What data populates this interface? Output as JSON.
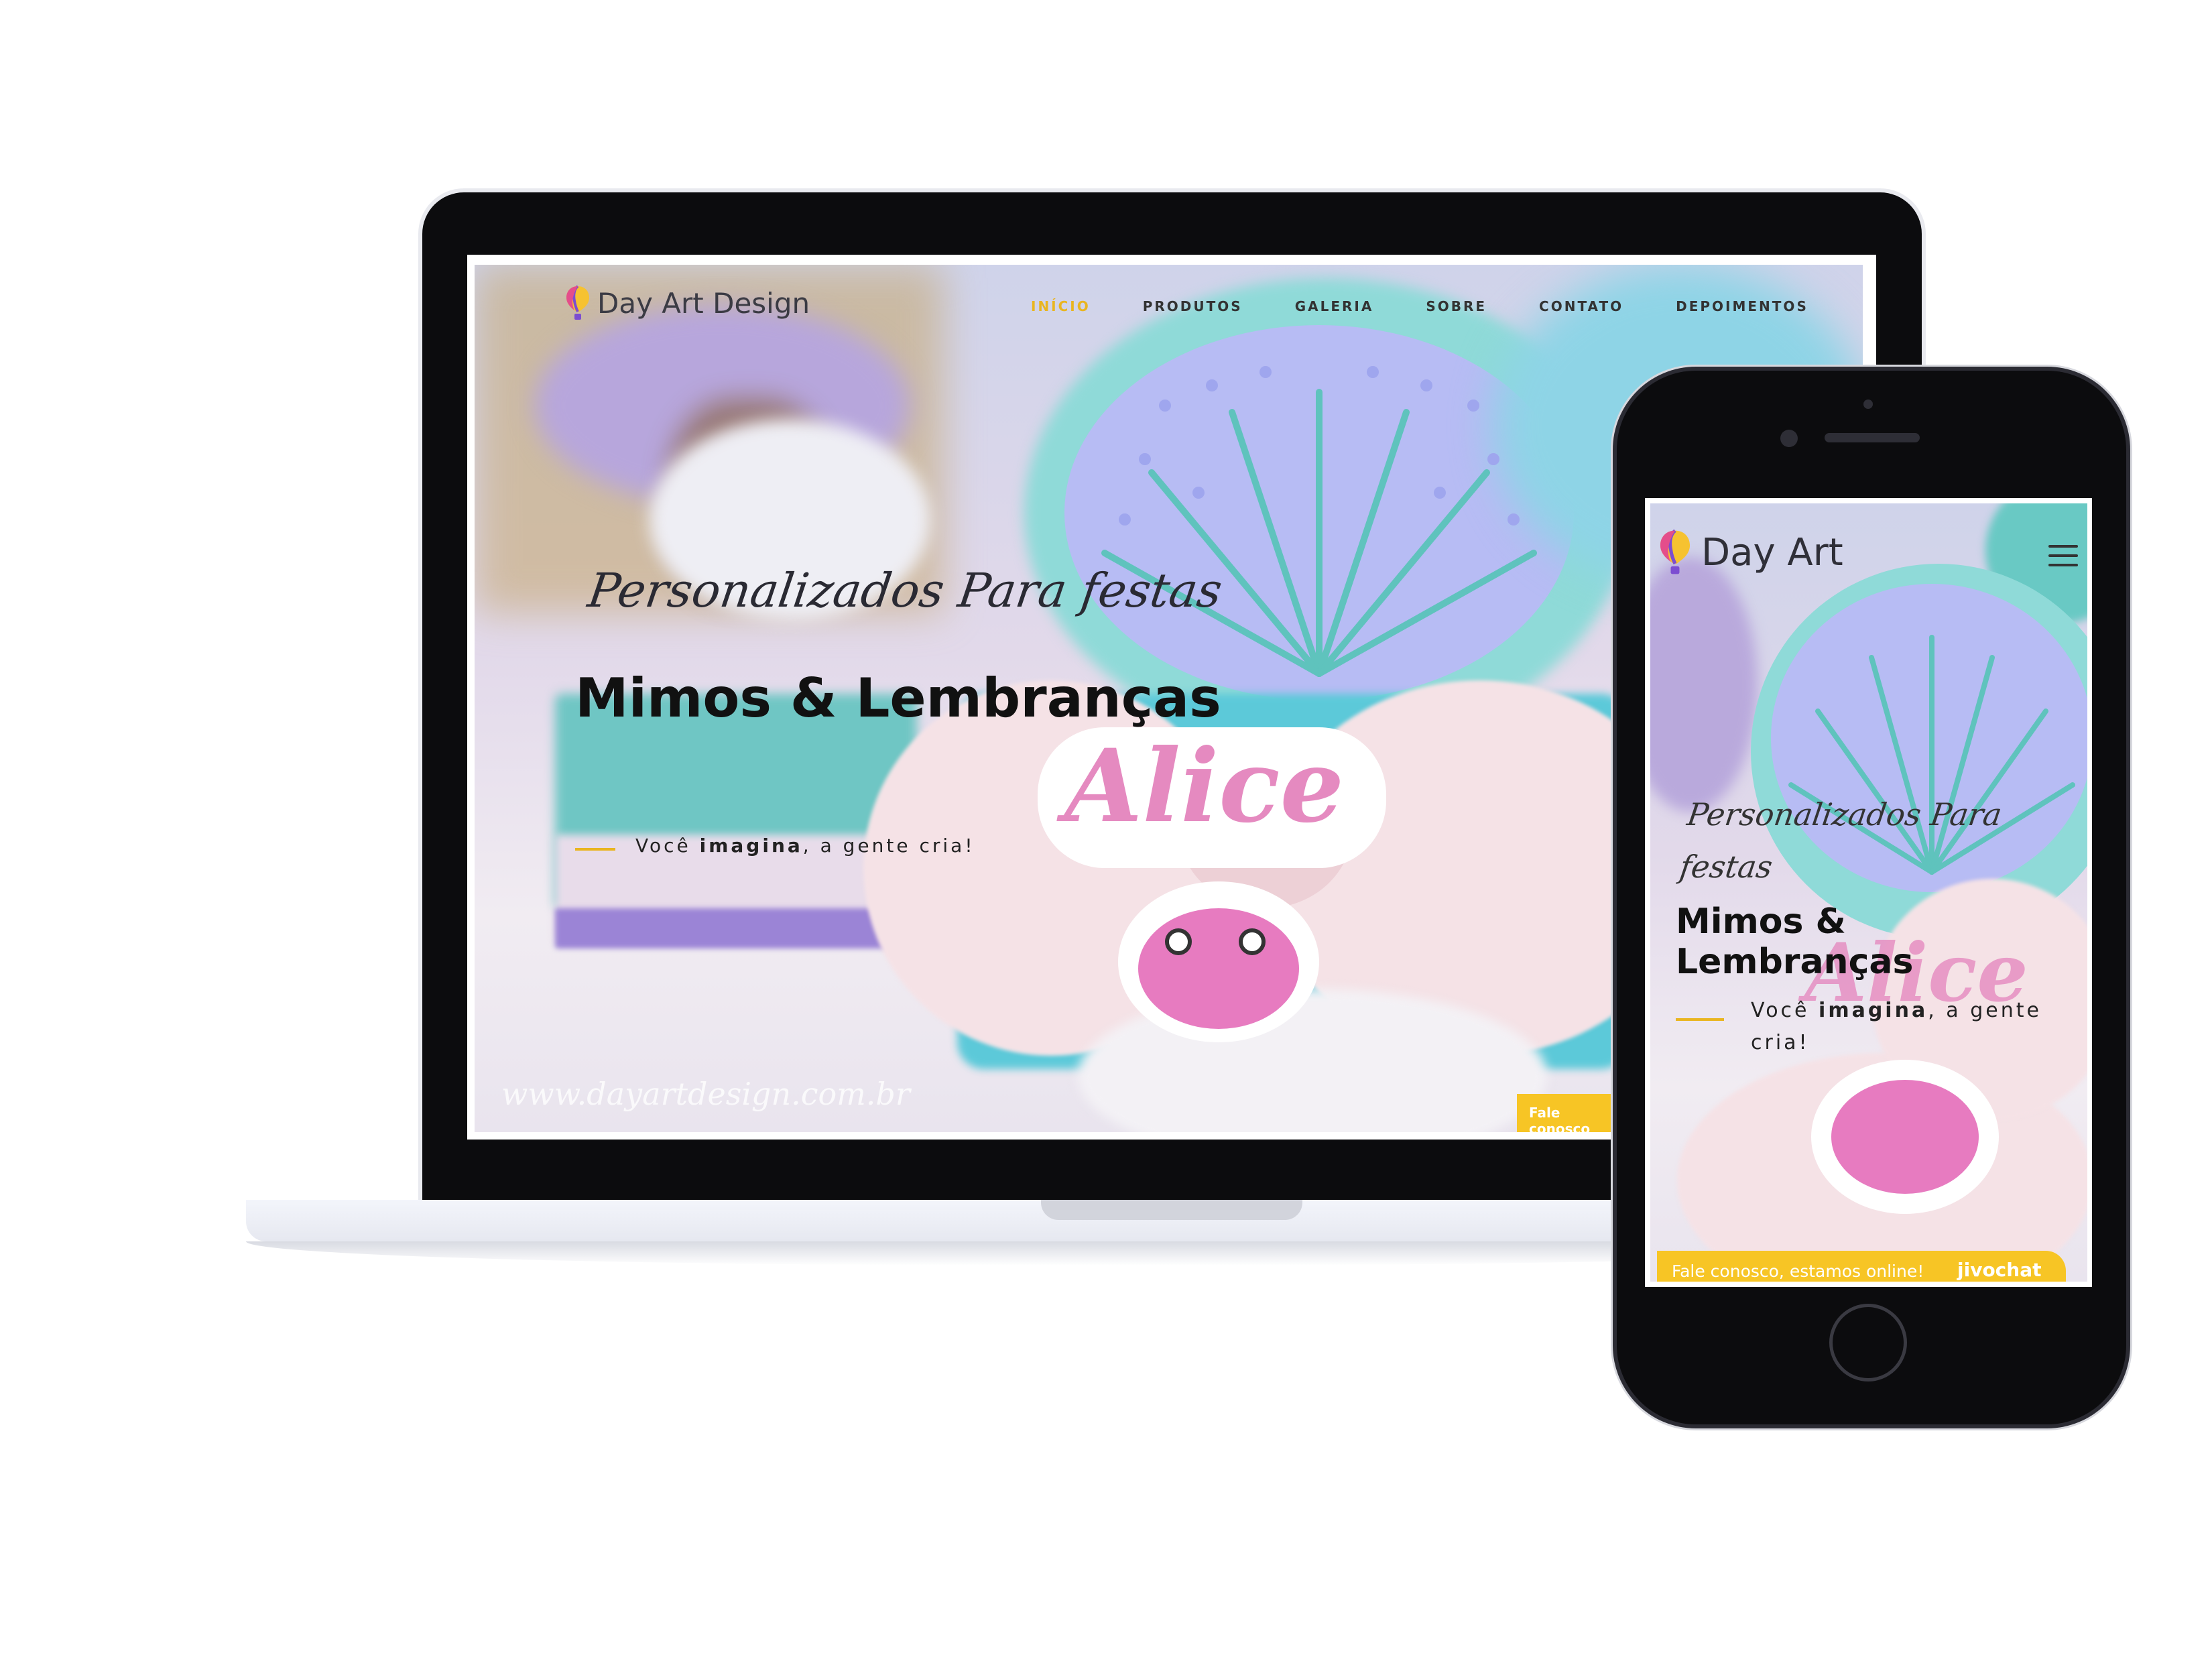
{
  "desktop": {
    "brand": "Day Art Design",
    "nav": [
      {
        "label": "INÍCIO",
        "active": true
      },
      {
        "label": "PRODUTOS",
        "active": false
      },
      {
        "label": "GALERIA",
        "active": false
      },
      {
        "label": "SOBRE",
        "active": false
      },
      {
        "label": "CONTATO",
        "active": false
      },
      {
        "label": "DEPOIMENTOS",
        "active": false
      }
    ],
    "tagline": "Personalizados Para festas",
    "title": "Mimos & Lembranças",
    "slogan_pre": "Você ",
    "slogan_bold": "imagina",
    "slogan_post": ", a gente cria!",
    "watermark": "www.dayartdesign.com.br",
    "chat_label": "Fale conosco"
  },
  "mobile": {
    "brand": "Day Art",
    "menu_icon": "hamburger-icon",
    "tagline": "Personalizados Para festas",
    "title": "Mimos & Lembranças",
    "slogan_pre": "Você ",
    "slogan_bold": "imagina",
    "slogan_post": ", a gente cria!",
    "chat_label": "Fale conosco, estamos online!",
    "chat_brand": "jivochat"
  },
  "colors": {
    "accent": "#e9b520",
    "chat": "#f7c525",
    "device": "#0c0c0e"
  },
  "icons": [
    "balloon-logo-icon",
    "hamburger-icon"
  ]
}
